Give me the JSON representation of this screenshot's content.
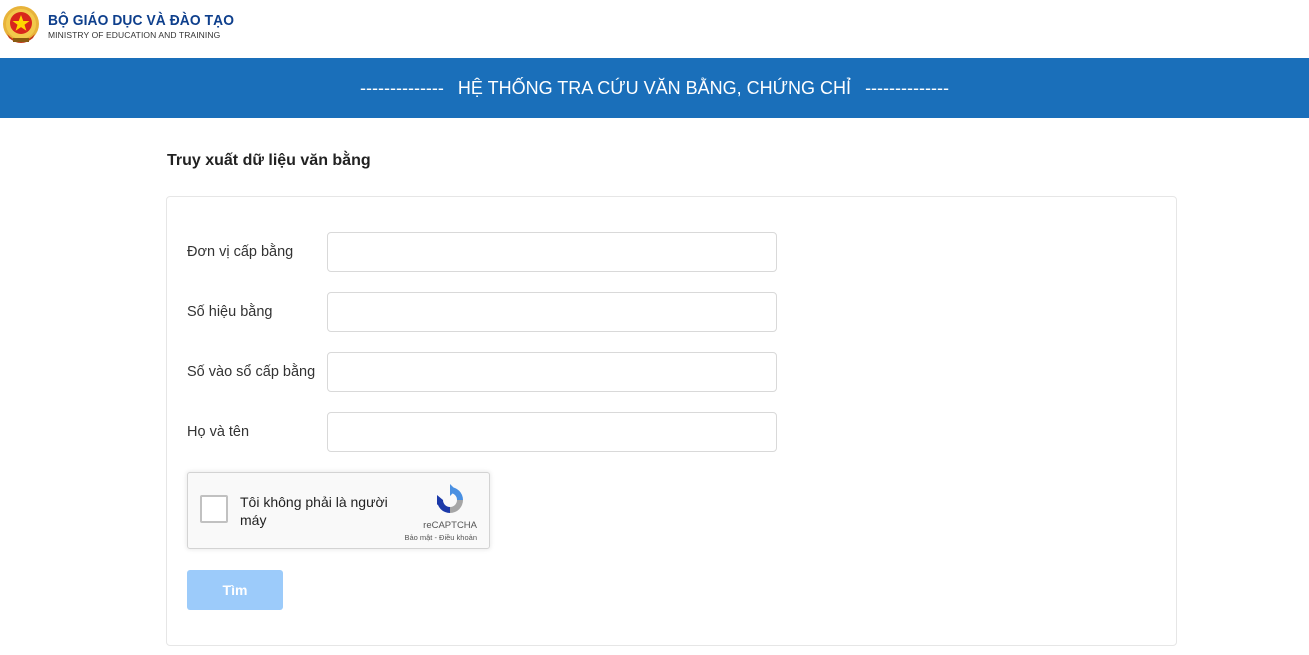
{
  "header": {
    "logo": "national-emblem-icon",
    "title": "BỘ GIÁO DỤC VÀ ĐÀO TẠO",
    "subtitle": "MINISTRY OF EDUCATION AND TRAINING"
  },
  "banner": {
    "dash_left": "--------------",
    "title": "HỆ THỐNG TRA CỨU VĂN BẰNG, CHỨNG CHỈ",
    "dash_right": "--------------",
    "color": "#1a6fba"
  },
  "form": {
    "title": "Truy xuất dữ liệu văn bằng",
    "fields": [
      {
        "label": "Đơn vị cấp bằng",
        "value": ""
      },
      {
        "label": "Số hiệu bằng",
        "value": ""
      },
      {
        "label": "Số vào sổ cấp bằng",
        "value": ""
      },
      {
        "label": "Họ và tên",
        "value": ""
      }
    ],
    "captcha": {
      "label": "Tôi không phải là người máy",
      "brand": "reCAPTCHA",
      "links": "Bảo mật - Điều khoản",
      "icon": "recaptcha-icon"
    },
    "search_button": "Tìm",
    "search_button_color": "#9ccbfa"
  }
}
